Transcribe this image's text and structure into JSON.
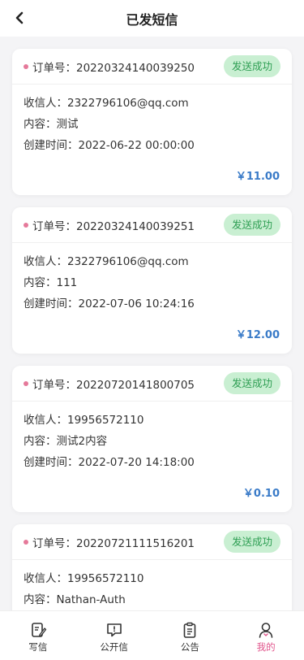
{
  "header": {
    "title": "已发短信",
    "back_icon": "chevron-left-icon"
  },
  "labels": {
    "order": "订单号：",
    "recipient": "收信人：",
    "content": "内容：",
    "created": "创建时间："
  },
  "orders": [
    {
      "order_no": "20220324140039250",
      "status": "发送成功",
      "recipient": "2322796106@qq.com",
      "content": "测试",
      "created": "2022-06-22 00:00:00",
      "price": "￥11.00"
    },
    {
      "order_no": "20220324140039251",
      "status": "发送成功",
      "recipient": "2322796106@qq.com",
      "content": "111",
      "created": "2022-07-06 10:24:16",
      "price": "￥12.00"
    },
    {
      "order_no": "20220720141800705",
      "status": "发送成功",
      "recipient": "19956572110",
      "content": "测试2内容",
      "created": "2022-07-20 14:18:00",
      "price": "￥0.10"
    },
    {
      "order_no": "20220721111516201",
      "status": "发送成功",
      "recipient": "19956572110",
      "content": "Nathan-Auth",
      "created": "",
      "price": ""
    }
  ],
  "tabbar": [
    {
      "label": "写信",
      "icon": "write-letter-icon"
    },
    {
      "label": "公开信",
      "icon": "public-letter-icon"
    },
    {
      "label": "公告",
      "icon": "notice-icon"
    },
    {
      "label": "我的",
      "icon": "profile-icon",
      "active": true
    }
  ],
  "colors": {
    "accent_pink": "#e0528a",
    "status_bg": "#c9efd2",
    "status_text": "#2e9e53",
    "price": "#3a7bc8"
  }
}
